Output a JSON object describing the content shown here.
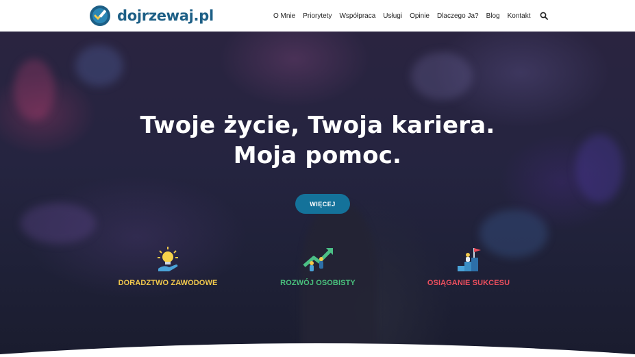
{
  "site": {
    "logo_text": "dojrzewaj.pl",
    "brand_color": "#1d5f86"
  },
  "nav": {
    "items": [
      "O Mnie",
      "Priorytety",
      "Współpraca",
      "Usługi",
      "Opinie",
      "Dlaczego Ja?",
      "Blog",
      "Kontakt"
    ],
    "search_icon": "search-icon"
  },
  "hero": {
    "title_line1": "Twoje życie, Twoja kariera.",
    "title_line2": "Moja pomoc.",
    "button_label": "WIĘCEJ",
    "button_color": "#14729a"
  },
  "features": [
    {
      "label": "DORADZTWO ZAWODOWE",
      "color": "#f2c94c",
      "icon": "lightbulb-hand-icon"
    },
    {
      "label": "ROZWÓJ OSOBISTY",
      "color": "#49c27d",
      "icon": "growth-arrow-icon"
    },
    {
      "label": "OSIĄGANIE SUKCESU",
      "color": "#ef4f5e",
      "icon": "success-flag-icon"
    }
  ]
}
